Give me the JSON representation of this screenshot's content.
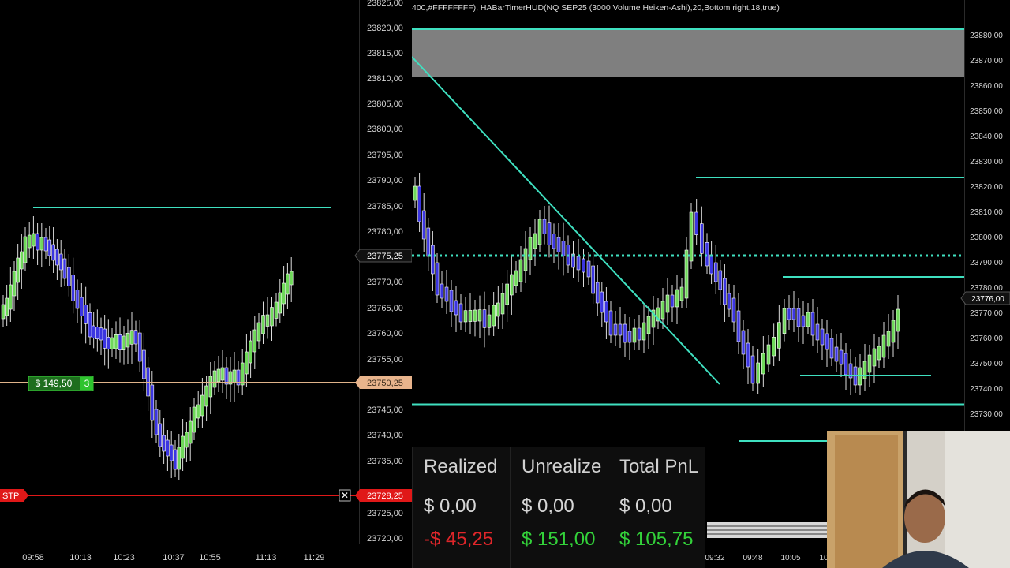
{
  "left_chart": {
    "price_labels": [
      "23825,00",
      "23820,00",
      "23815,00",
      "23810,00",
      "23805,00",
      "23800,00",
      "23795,00",
      "23790,00",
      "23785,00",
      "23780,00",
      "23775,25",
      "23770,00",
      "23765,00",
      "23760,00",
      "23755,00",
      "23750,25",
      "23745,00",
      "23740,00",
      "23735,00",
      "23728,25",
      "23725,00",
      "23720,00"
    ],
    "current_price_tag": "23775,25",
    "avg_price_tag": "23750,25",
    "stop_price_tag": "23728,25",
    "time_labels": [
      "09:58",
      "10:13",
      "10:23",
      "10:37",
      "10:55",
      "11:13",
      "11:29"
    ],
    "position_pnl": "$ 149,50",
    "position_qty": "3",
    "stop_label": "STP",
    "close_glyph": "✕"
  },
  "right_chart": {
    "indicator_text": "400,#FFFFFFFF), HABarTimerHUD(NQ SEP25 (3000 Volume Heiken-Ashi),20,Bottom right,18,true)",
    "price_labels": [
      "23880,00",
      "23870,00",
      "23860,00",
      "23850,00",
      "23840,00",
      "23830,00",
      "23820,00",
      "23810,00",
      "23800,00",
      "23790,00",
      "23780,00",
      "23776,00",
      "23770,00",
      "23760,00",
      "23750,00",
      "23740,00",
      "23730,00"
    ],
    "current_price_tag": "23776,00",
    "time_labels": [
      "09:32",
      "09:48",
      "10:05",
      "10"
    ]
  },
  "pnl": {
    "columns": [
      {
        "header": "Realized",
        "row1": "$ 0,00",
        "row2": "-$ 45,25",
        "row2_sign": "neg"
      },
      {
        "header": "Unrealize",
        "row1": "$ 0,00",
        "row2": "$ 151,00",
        "row2_sign": "pos"
      },
      {
        "header": "Total PnL",
        "row1": "$ 0,00",
        "row2": "$ 105,75",
        "row2_sign": "pos"
      }
    ]
  },
  "colors": {
    "bull_candle": "#6fd85a",
    "bear_candle": "#3b35e0",
    "line_cyan": "#3fe0c0",
    "avg_line": "#e0b38a",
    "stop_red": "#e01818",
    "position_green": "#2ca52c"
  }
}
